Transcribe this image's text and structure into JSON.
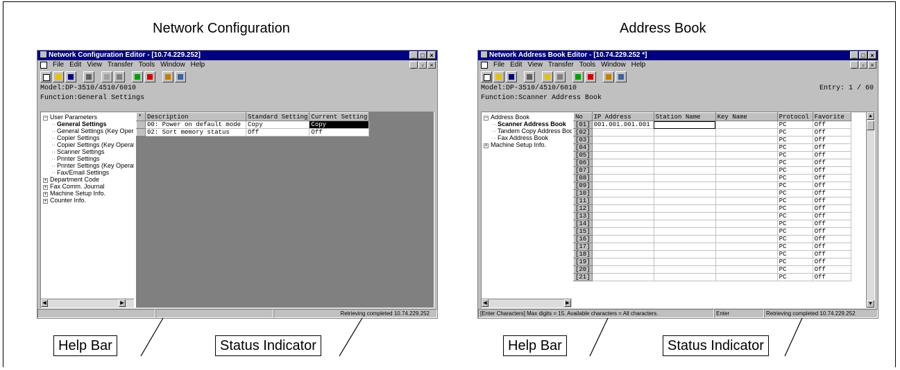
{
  "left_panel": {
    "heading": "Network Configuration",
    "window": {
      "title": "Network Configuration Editor - [10.74.229.252]",
      "menu": [
        "File",
        "Edit",
        "View",
        "Transfer",
        "Tools",
        "Window",
        "Help"
      ],
      "model": "Model:DP-3510/4510/6010",
      "function": "Function:General Settings",
      "tree": [
        {
          "label": "User Parameters",
          "expander": "⊟",
          "level": 0
        },
        {
          "label": "General Settings",
          "level": 1,
          "selected": true
        },
        {
          "label": "General Settings (Key Opera",
          "level": 1
        },
        {
          "label": "Copier Settings",
          "level": 1
        },
        {
          "label": "Copier Settings (Key Operatc",
          "level": 1
        },
        {
          "label": "Scanner Settings",
          "level": 1
        },
        {
          "label": "Printer Settings",
          "level": 1
        },
        {
          "label": "Printer Settings (Key Operatc",
          "level": 1
        },
        {
          "label": "Fax/Email Settings",
          "level": 1
        },
        {
          "label": "Department Code",
          "expander": "⊞",
          "level": 0
        },
        {
          "label": "Fax Comm. Journal",
          "expander": "⊞",
          "level": 0
        },
        {
          "label": "Machine Setup Info.",
          "expander": "⊞",
          "level": 0
        },
        {
          "label": "Counter Info.",
          "expander": "⊞",
          "level": 0
        }
      ],
      "table": {
        "headers": [
          "*",
          "Description",
          "Standard Setting",
          "Current Setting"
        ],
        "rows": [
          [
            "",
            "00: Power on default mode",
            "Copy",
            "Copy"
          ],
          [
            "",
            "02: Sort memory status",
            "Off",
            "Off"
          ]
        ]
      },
      "status_text": "Retrieving completed 10.74.229.252"
    },
    "callouts": {
      "help_bar": "Help Bar",
      "status_indicator": "Status Indicator"
    }
  },
  "right_panel": {
    "heading": "Address Book",
    "window": {
      "title": "Network Address Book Editor - [10.74.229.252 *]",
      "menu": [
        "File",
        "Edit",
        "View",
        "Transfer",
        "Tools",
        "Window",
        "Help"
      ],
      "model": "Model:DP-3510/4510/6010",
      "entry": "Entry:  1 / 60",
      "function": "Function:Scanner Address Book",
      "tree": [
        {
          "label": "Address Book",
          "expander": "⊟",
          "level": 0
        },
        {
          "label": "Scanner Address Book",
          "level": 1,
          "selected": true
        },
        {
          "label": "Tandem Copy Address Book",
          "level": 1
        },
        {
          "label": "Fax Address Book",
          "level": 1
        },
        {
          "label": "Machine Setup Info.",
          "expander": "⊞",
          "level": 0
        }
      ],
      "table": {
        "headers": [
          "No",
          "IP Address",
          "Station Name",
          "Key Name",
          "Protocol",
          "Favorite"
        ],
        "rows": [
          [
            "[01]",
            "001.001.001.001",
            "",
            "",
            "PC",
            "Off"
          ],
          [
            "[02]",
            "",
            "",
            "",
            "PC",
            "Off"
          ],
          [
            "[03]",
            "",
            "",
            "",
            "PC",
            "Off"
          ],
          [
            "[04]",
            "",
            "",
            "",
            "PC",
            "Off"
          ],
          [
            "[05]",
            "",
            "",
            "",
            "PC",
            "Off"
          ],
          [
            "[06]",
            "",
            "",
            "",
            "PC",
            "Off"
          ],
          [
            "[07]",
            "",
            "",
            "",
            "PC",
            "Off"
          ],
          [
            "[08]",
            "",
            "",
            "",
            "PC",
            "Off"
          ],
          [
            "[09]",
            "",
            "",
            "",
            "PC",
            "Off"
          ],
          [
            "[10]",
            "",
            "",
            "",
            "PC",
            "Off"
          ],
          [
            "[11]",
            "",
            "",
            "",
            "PC",
            "Off"
          ],
          [
            "[12]",
            "",
            "",
            "",
            "PC",
            "Off"
          ],
          [
            "[13]",
            "",
            "",
            "",
            "PC",
            "Off"
          ],
          [
            "[14]",
            "",
            "",
            "",
            "PC",
            "Off"
          ],
          [
            "[15]",
            "",
            "",
            "",
            "PC",
            "Off"
          ],
          [
            "[16]",
            "",
            "",
            "",
            "PC",
            "Off"
          ],
          [
            "[17]",
            "",
            "",
            "",
            "PC",
            "Off"
          ],
          [
            "[18]",
            "",
            "",
            "",
            "PC",
            "Off"
          ],
          [
            "[19]",
            "",
            "",
            "",
            "PC",
            "Off"
          ],
          [
            "[20]",
            "",
            "",
            "",
            "PC",
            "Off"
          ],
          [
            "[21]",
            "",
            "",
            "",
            "PC",
            "Off"
          ]
        ]
      },
      "help_text": "[Enter Characters] Max digits = 15. Available characters = All characters.",
      "key_hint": "Enter",
      "status_text": "Retrieving completed 10.74.229.252"
    },
    "callouts": {
      "help_bar": "Help Bar",
      "status_indicator": "Status Indicator"
    }
  }
}
